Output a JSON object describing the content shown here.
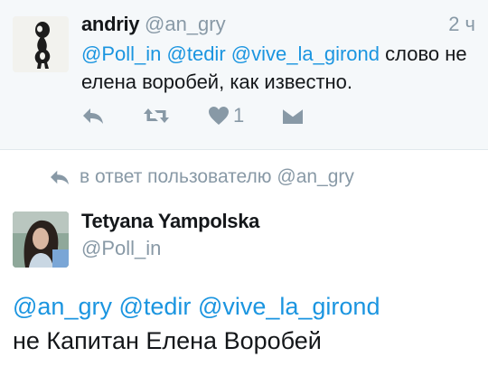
{
  "parent_tweet": {
    "name": "andriy",
    "handle": "@an_gry",
    "time": "2 ч",
    "mentions": [
      "@Poll_in",
      "@tedir",
      "@vive_la_girond"
    ],
    "text_rest": "слово не елена воробей, как известно.",
    "like_count": "1",
    "icons": [
      "reply-icon",
      "retweet-icon",
      "heart-icon",
      "direct-message-icon"
    ]
  },
  "reply_context": {
    "text": "в ответ пользователю @an_gry",
    "icon": "reply-icon"
  },
  "main_tweet": {
    "name": "Tetyana Yampolska",
    "handle": "@Poll_in",
    "mentions": [
      "@an_gry",
      "@tedir",
      "@vive_la_girond"
    ],
    "text_rest": "не Капитан Елена Воробей"
  },
  "colors": {
    "link": "#1b95e0",
    "muted": "#8899a6",
    "text": "#14171a",
    "parent_bg": "#f5f8fa"
  }
}
